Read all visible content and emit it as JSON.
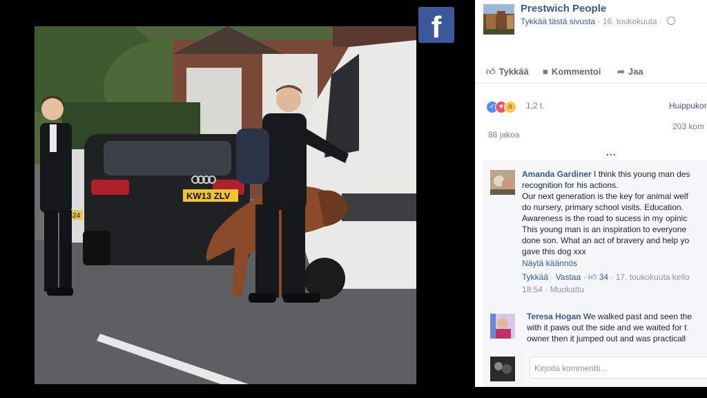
{
  "photo": {
    "plate_front": "KW13 ZLV",
    "plate_side": "RG24"
  },
  "brand": {
    "logo_letter": "f"
  },
  "post": {
    "page_name": "Prestwich People",
    "like_page": "Tykkää tästä sivusta",
    "separator": " · ",
    "date": "16. toukokuuta",
    "separator2": " · "
  },
  "actions": {
    "like": "Tykkää",
    "comment": "Kommentoi",
    "share": "Jaa"
  },
  "reactions": {
    "count": "1,2 t.",
    "top_comments": "Huippukom",
    "shares": "88 jakoa",
    "comments": "203 kom",
    "more": "..."
  },
  "comments": [
    {
      "author": "Amanda Gardiner",
      "lines": [
        "I think this young man des",
        "recognition for his actions.",
        "Our next generation is the key for animal welf",
        "do nursery, primary school visits. Education.",
        "Awareness is the road to sucess in my opinic",
        "This young man is an inspiration to everyone",
        "done son. What an act of bravery and help yo",
        "gave this dog xxx"
      ],
      "translate": "Näytä käännös",
      "like": "Tykkää",
      "reply": "Vastaa",
      "likes": "34",
      "date": "17. toukokuuta kello",
      "time": "18:54",
      "edited": "Muokattu",
      "dot": " · "
    },
    {
      "author": "Teresa Hogan",
      "lines": [
        "We walked past and seen the",
        "with it paws out the side and we waited for t",
        "owner then it jumped out and was practicall"
      ]
    }
  ],
  "composer": {
    "placeholder": "Kirjoita kommentti..."
  },
  "colors": {
    "facebook_blue": "#3b5998",
    "link_blue": "#365899",
    "meta_gray": "#90949c"
  }
}
